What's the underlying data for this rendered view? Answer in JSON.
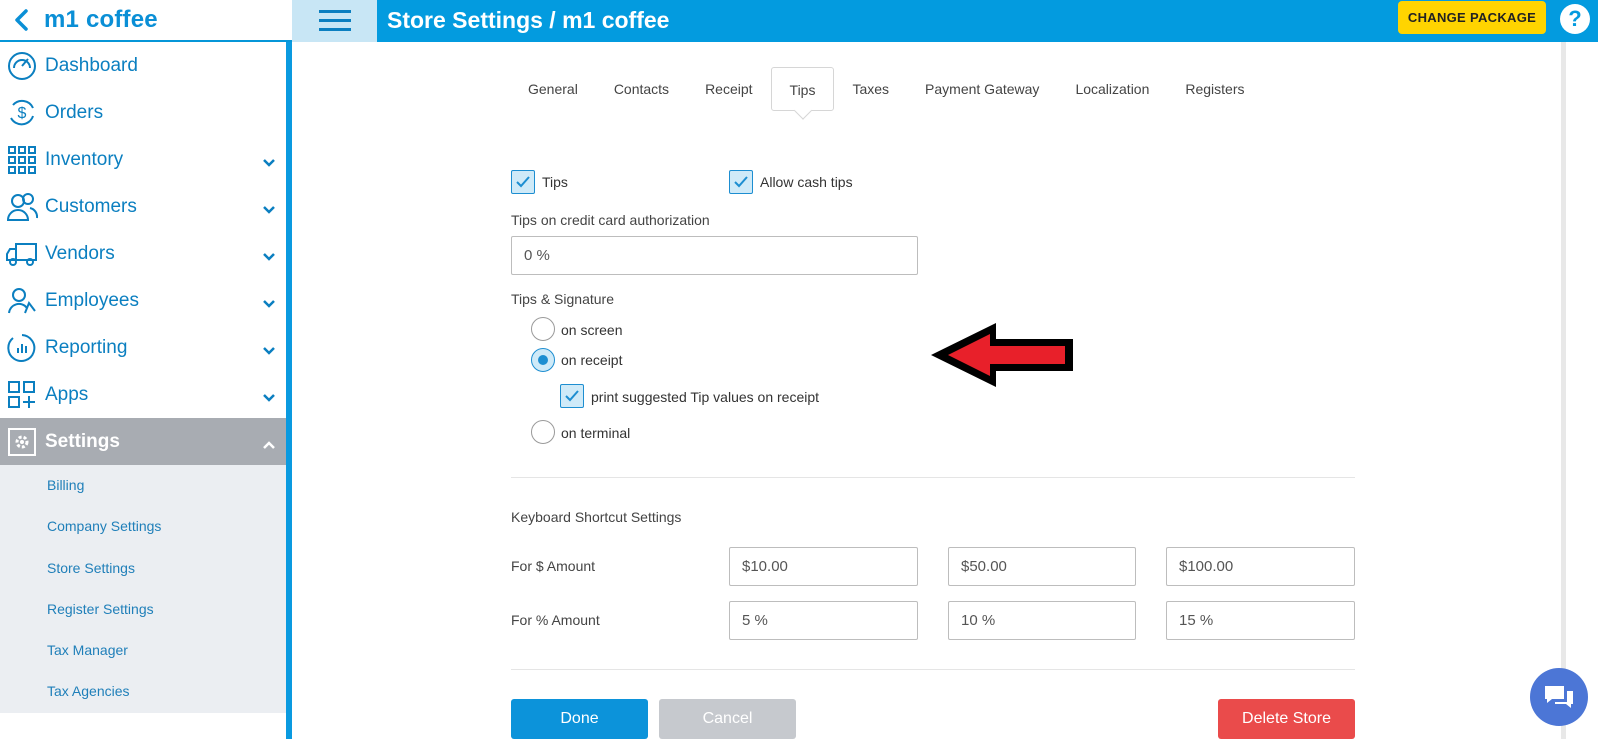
{
  "brand": {
    "title": "m1 coffee"
  },
  "header": {
    "title": "Store Settings / m1 coffee",
    "change_package": "CHANGE PACKAGE",
    "help": "?"
  },
  "sidebar": {
    "items": [
      {
        "label": "Dashboard",
        "icon": "dashboard-icon"
      },
      {
        "label": "Orders",
        "icon": "dollar-refresh-icon"
      },
      {
        "label": "Inventory",
        "icon": "grid-icon"
      },
      {
        "label": "Customers",
        "icon": "users-icon"
      },
      {
        "label": "Vendors",
        "icon": "truck-icon"
      },
      {
        "label": "Employees",
        "icon": "employee-icon"
      },
      {
        "label": "Reporting",
        "icon": "chart-icon"
      },
      {
        "label": "Apps",
        "icon": "apps-icon"
      },
      {
        "label": "Settings",
        "icon": "gear-icon"
      }
    ],
    "settings_sub": [
      "Billing",
      "Company Settings",
      "Store Settings",
      "Register Settings",
      "Tax Manager",
      "Tax Agencies"
    ]
  },
  "tabs": [
    "General",
    "Contacts",
    "Receipt",
    "Tips",
    "Taxes",
    "Payment Gateway",
    "Localization",
    "Registers"
  ],
  "active_tab": "Tips",
  "tips": {
    "tips_label": "Tips",
    "tips_checked": true,
    "allow_cash_label": "Allow cash tips",
    "allow_cash_checked": true,
    "cc_auth_label": "Tips on credit card authorization",
    "cc_auth_value": "0 %",
    "signature_label": "Tips & Signature",
    "options": [
      "on screen",
      "on receipt",
      "on terminal"
    ],
    "selected_option": "on receipt",
    "print_suggested_label": "print suggested Tip values on receipt",
    "print_suggested_checked": true
  },
  "shortcuts": {
    "title": "Keyboard Shortcut Settings",
    "dollar_label": "For $ Amount",
    "dollar_values": [
      "$10.00",
      "$50.00",
      "$100.00"
    ],
    "percent_label": "For % Amount",
    "percent_values": [
      "5 %",
      "10 %",
      "15 %"
    ]
  },
  "buttons": {
    "done": "Done",
    "cancel": "Cancel",
    "delete": "Delete Store"
  },
  "colors": {
    "primary": "#039bdf",
    "accent_yellow": "#ffd400",
    "danger": "#ea4b4b",
    "annotation_arrow": "#e8202a"
  }
}
